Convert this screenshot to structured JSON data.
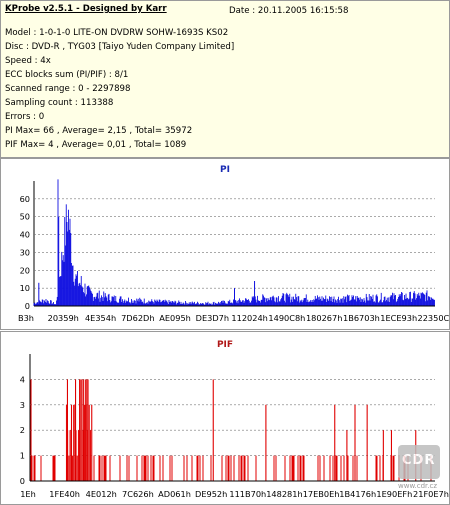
{
  "header": {
    "title": "KProbe v2.5.1 - Designed by Karr",
    "date": "Date : 20.11.2005 16:15:58",
    "lines": [
      "Model : 1-0-1-0 LITE-ON DVDRW SOHW-1693S KS02",
      "Disc : DVD-R , TYG03 [Taiyo Yuden Company Limited]",
      "Speed : 4x",
      "ECC blocks sum (PI/PIF) : 8/1",
      "Scanned range : 0 - 2297898",
      "Sampling count : 113388",
      "Errors : 0",
      "PI Max= 66 , Average= 2,15 , Total= 35972",
      "PIF Max= 4 , Average= 0,01 , Total= 1089"
    ]
  },
  "colors": {
    "pi": "#1010e0",
    "pif": "#e00000",
    "info_bg": "#ffffe6",
    "pi_title": "#1a2bb4",
    "pif_title": "#b01818"
  },
  "watermark": {
    "logo": "CDR",
    "site": "www.cdr.cz"
  },
  "chart_data": [
    {
      "type": "area",
      "title": "PI",
      "ylim": [
        0,
        70
      ],
      "yticks": [
        0,
        10,
        20,
        30,
        40,
        50,
        60
      ],
      "xticks": [
        "B3h",
        "20359h",
        "4E354h",
        "7D62Dh",
        "AE095h",
        "DE3D7h",
        "112024h",
        "1490C8h",
        "180267h",
        "1B6703h",
        "1ECE93h",
        "22350Ch"
      ],
      "x_fraction": [
        0,
        0.03,
        0.055,
        0.085,
        0.1,
        0.14,
        0.2,
        0.3,
        0.4,
        0.45,
        0.5,
        0.6,
        0.7,
        0.8,
        0.9,
        1.0
      ],
      "values": [
        2,
        4,
        1,
        62,
        20,
        8,
        5,
        3,
        2,
        2,
        3,
        6,
        5,
        5,
        6,
        7
      ],
      "spikes": [
        {
          "x_fraction": 0.55,
          "value": 14
        },
        {
          "x_fraction": 0.5,
          "value": 10
        },
        {
          "x_fraction": 0.012,
          "value": 13
        }
      ]
    },
    {
      "type": "bar",
      "title": "PIF",
      "ylim": [
        0,
        5
      ],
      "yticks": [
        0,
        1,
        2,
        3,
        4
      ],
      "xticks": [
        "1Eh",
        "1FE40h",
        "4E012h",
        "7C626h",
        "AD061h",
        "DE952h",
        "111B70h",
        "148281h",
        "17EB0Eh",
        "1B4176h",
        "1E90EFh",
        "21F0E7h"
      ],
      "clusters": [
        {
          "x_fraction": 0.0,
          "value": 4
        },
        {
          "x_fraction": 0.09,
          "value": 4
        },
        {
          "x_fraction": 0.1,
          "value": 3
        },
        {
          "x_fraction": 0.11,
          "value": 4
        },
        {
          "x_fraction": 0.12,
          "value": 4
        },
        {
          "x_fraction": 0.13,
          "value": 4
        },
        {
          "x_fraction": 0.135,
          "value": 3
        },
        {
          "x_fraction": 0.14,
          "value": 2
        },
        {
          "x_fraction": 0.15,
          "value": 3
        },
        {
          "x_fraction": 0.45,
          "value": 4
        },
        {
          "x_fraction": 0.58,
          "value": 3
        },
        {
          "x_fraction": 0.75,
          "value": 3
        },
        {
          "x_fraction": 0.78,
          "value": 2
        },
        {
          "x_fraction": 0.8,
          "value": 3
        },
        {
          "x_fraction": 0.83,
          "value": 3
        },
        {
          "x_fraction": 0.87,
          "value": 2
        },
        {
          "x_fraction": 0.89,
          "value": 2
        },
        {
          "x_fraction": 0.95,
          "value": 2
        }
      ],
      "baseline_value": 1,
      "baseline_density": 0.22
    }
  ]
}
